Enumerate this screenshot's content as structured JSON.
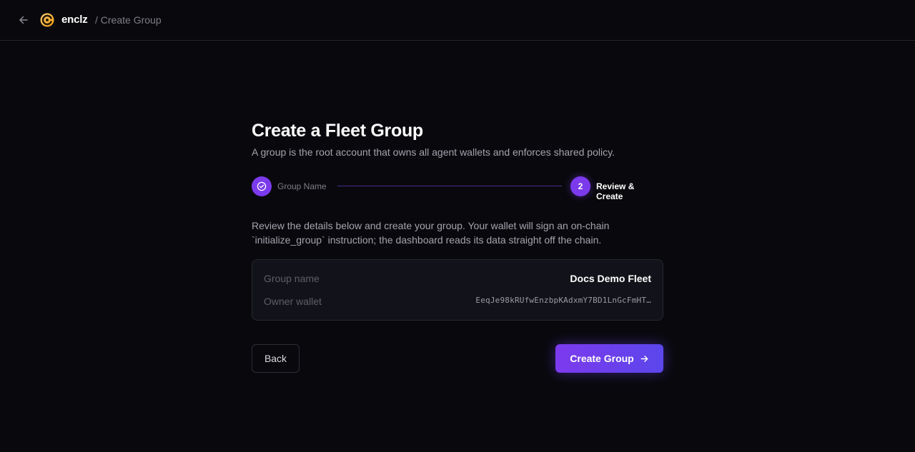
{
  "header": {
    "brand": "enclz",
    "breadcrumb": "/ Create Group"
  },
  "page": {
    "title": "Create a Fleet Group",
    "subtitle": "A group is the root account that owns all agent wallets and enforces shared policy."
  },
  "stepper": {
    "steps": [
      {
        "number": "1",
        "label": "Group Name",
        "state": "complete"
      },
      {
        "number": "2",
        "label": "Review & Create",
        "state": "active"
      }
    ]
  },
  "review": {
    "description": "Review the details below and create your group. Your wallet will sign an on-chain `initialize_group` instruction; the dashboard reads its data straight off the chain.",
    "rows": [
      {
        "label": "Group name",
        "value": "Docs Demo Fleet"
      },
      {
        "label": "Owner wallet",
        "value": "EeqJe98kRUfwEnzbpKAdxmY7BD1LnGcFmHT…"
      }
    ]
  },
  "actions": {
    "back_label": "Back",
    "create_label": "Create Group"
  },
  "colors": {
    "accent": "#7c3aed",
    "background": "#09090d",
    "card": "#12131a"
  },
  "icons": {
    "back": "arrow-left-icon",
    "logo": "enclz-logo-icon",
    "step_complete": "check-circle-icon",
    "create": "arrow-right-icon"
  }
}
